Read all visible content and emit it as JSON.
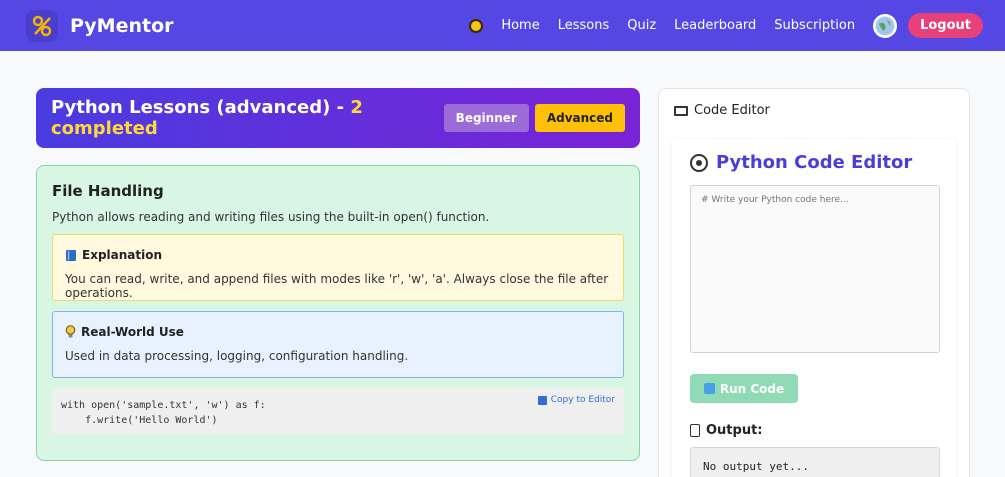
{
  "nav": {
    "brand": "PyMentor",
    "links": [
      "Home",
      "Lessons",
      "Quiz",
      "Leaderboard",
      "Subscription"
    ],
    "logout": "Logout"
  },
  "lessons_header": {
    "title": "Python Lessons (advanced) - ",
    "completed": "2 completed",
    "beginner_label": "Beginner",
    "advanced_label": "Advanced"
  },
  "lesson": {
    "title": "File Handling",
    "description": "Python allows reading and writing files using the built-in open() function.",
    "explanation_heading": "Explanation",
    "explanation_text": "You can read, write, and append files with modes like 'r', 'w', 'a'. Always close the file after operations.",
    "realworld_heading": "Real-World Use",
    "realworld_text": "Used in data processing, logging, configuration handling.",
    "code_lines": [
      "with open('sample.txt', 'w') as f:",
      "    f.write('Hello World')"
    ],
    "copy_label": "Copy to Editor"
  },
  "editor": {
    "panel_title": "Code Editor",
    "title": "Python Code Editor",
    "placeholder": "# Write your Python code here...",
    "run_label": "Run Code",
    "output_heading": "Output:",
    "output_text": "No output yet..."
  },
  "colors": {
    "nav_bg": "#5447e3",
    "accent": "#ffc107",
    "logout": "#e8407a",
    "editor_title": "#4b3ed6"
  }
}
